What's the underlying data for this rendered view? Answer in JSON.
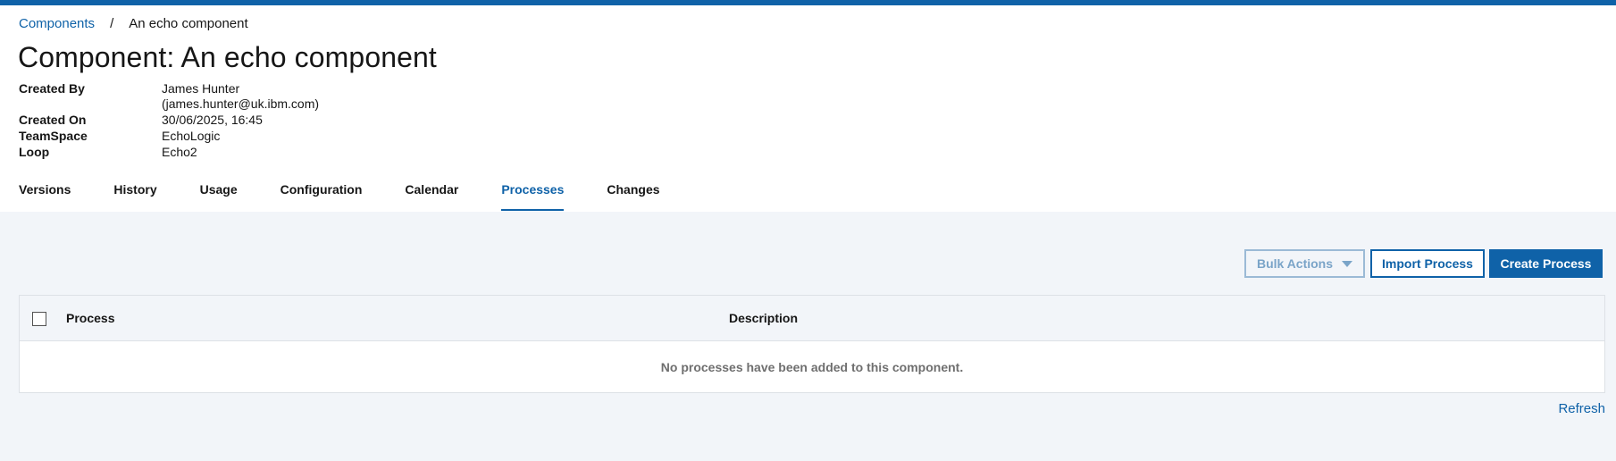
{
  "breadcrumb": {
    "root": "Components",
    "separator": "/",
    "current": "An echo component"
  },
  "page_title": "Component: An echo component",
  "meta": {
    "created_by_label": "Created By",
    "created_by_name": "James Hunter",
    "created_by_email": "(james.hunter@uk.ibm.com)",
    "created_on_label": "Created On",
    "created_on_value": "30/06/2025, 16:45",
    "teamspace_label": "TeamSpace",
    "teamspace_value": "EchoLogic",
    "loop_label": "Loop",
    "loop_value": "Echo2"
  },
  "tabs": [
    {
      "label": "Versions"
    },
    {
      "label": "History"
    },
    {
      "label": "Usage"
    },
    {
      "label": "Configuration"
    },
    {
      "label": "Calendar"
    },
    {
      "label": "Processes",
      "active": true
    },
    {
      "label": "Changes"
    }
  ],
  "toolbar": {
    "bulk_actions_label": "Bulk Actions",
    "import_label": "Import Process",
    "create_label": "Create Process"
  },
  "table": {
    "columns": [
      "Process",
      "Description"
    ],
    "empty_message": "No processes have been added to this component."
  },
  "refresh_label": "Refresh",
  "colors": {
    "accent": "#0f62a8",
    "content_bg": "#f2f5f9",
    "disabled": "#9bbad6"
  },
  "icons": {
    "bulk_caret": "caret-down-icon",
    "select_all": "checkbox-icon"
  }
}
